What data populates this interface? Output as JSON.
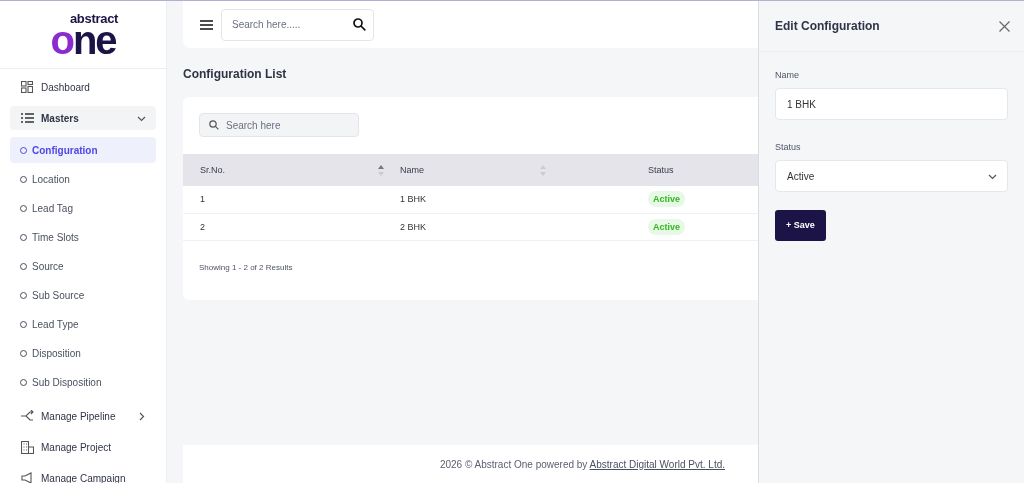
{
  "logo": {
    "top": "abstract",
    "bottom": "one"
  },
  "sidebar": {
    "items": [
      {
        "label": "Dashboard",
        "kind": "link"
      },
      {
        "label": "Masters",
        "kind": "group",
        "expanded": true,
        "children": [
          {
            "label": "Configuration",
            "selected": true
          },
          {
            "label": "Location",
            "selected": false
          },
          {
            "label": "Lead Tag",
            "selected": false
          },
          {
            "label": "Time Slots",
            "selected": false
          },
          {
            "label": "Source",
            "selected": false
          },
          {
            "label": "Sub Source",
            "selected": false
          },
          {
            "label": "Lead Type",
            "selected": false
          },
          {
            "label": "Disposition",
            "selected": false
          },
          {
            "label": "Sub Disposition",
            "selected": false
          }
        ]
      },
      {
        "label": "Manage Pipeline",
        "kind": "group",
        "expanded": false
      },
      {
        "label": "Manage Project",
        "kind": "link"
      },
      {
        "label": "Manage Campaign",
        "kind": "link"
      }
    ]
  },
  "topbar": {
    "search": {
      "placeholder": "Search here....."
    }
  },
  "page_title": "Configuration List",
  "table": {
    "search": {
      "placeholder": "Search here"
    },
    "columns": [
      {
        "label": "Sr.No.",
        "kind": "sortable",
        "sorted": true
      },
      {
        "label": "Name",
        "kind": "sortable",
        "sorted": false
      },
      {
        "label": "Status",
        "kind": "plain"
      }
    ],
    "rows": [
      {
        "sr_no": "1",
        "name": "1 BHK",
        "status": "Active"
      },
      {
        "sr_no": "2",
        "name": "2 BHK",
        "status": "Active"
      }
    ],
    "summary": "Showing 1 - 2 of 2 Results"
  },
  "footer": {
    "text": "2026 © Abstract One powered by ",
    "link": "Abstract Digital World Pvt. Ltd."
  },
  "drawer": {
    "title": "Edit Configuration",
    "fields": [
      {
        "label": "Name",
        "kind": "text",
        "value": "1 BHK"
      },
      {
        "label": "Status",
        "kind": "select",
        "value": "Active"
      }
    ],
    "button": {
      "icon": "+",
      "label": "Save"
    }
  }
}
